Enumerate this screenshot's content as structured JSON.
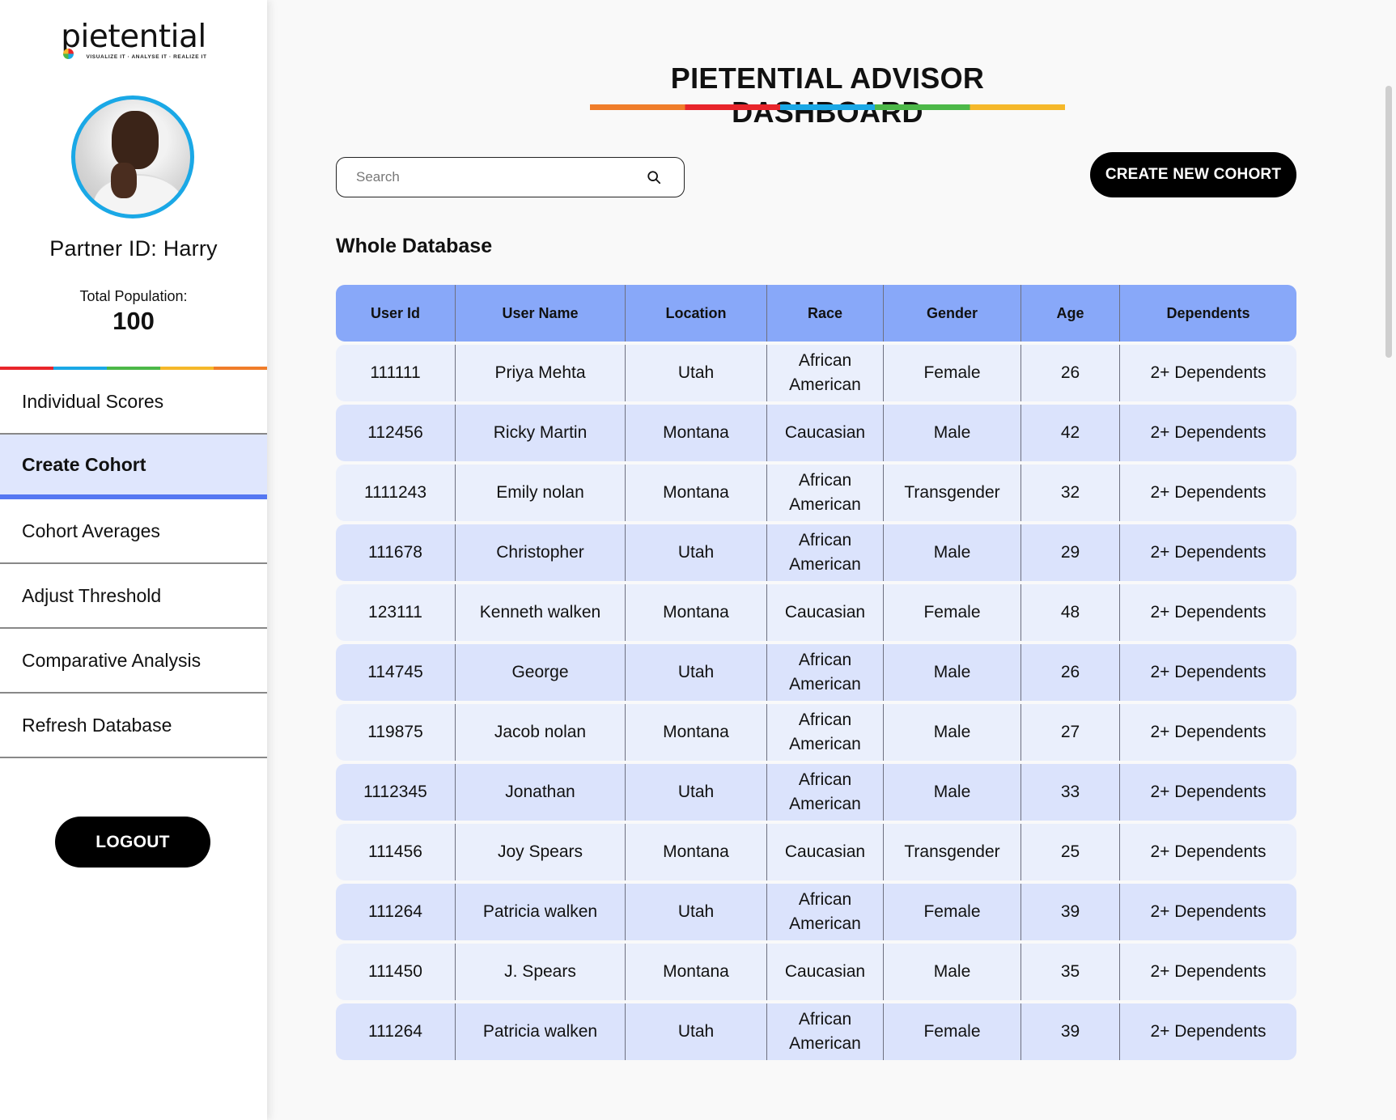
{
  "app": {
    "logo_text": "pietential",
    "logo_tagline": "VISUALIZE IT · ANALYSE IT · REALIZE IT"
  },
  "sidebar": {
    "partner_id": "Partner ID: Harry",
    "population_label": "Total Population:",
    "population_value": "100",
    "nav": [
      {
        "label": "Individual Scores",
        "active": false
      },
      {
        "label": "Create Cohort",
        "active": true
      },
      {
        "label": "Cohort Averages",
        "active": false
      },
      {
        "label": "Adjust Threshold",
        "active": false
      },
      {
        "label": "Comparative Analysis",
        "active": false
      },
      {
        "label": "Refresh Database",
        "active": false
      }
    ],
    "logout_label": "LOGOUT"
  },
  "header": {
    "title": "PIETENTIAL ADVISOR DASHBOARD"
  },
  "toolbar": {
    "search_placeholder": "Search",
    "search_value": "",
    "create_label": "CREATE NEW COHORT"
  },
  "section": {
    "title": "Whole Database"
  },
  "table": {
    "columns": [
      "User Id",
      "User Name",
      "Location",
      "Race",
      "Gender",
      "Age",
      "Dependents"
    ],
    "rows": [
      [
        "111111",
        "Priya Mehta",
        "Utah",
        "African American",
        "Female",
        "26",
        "2+ Dependents"
      ],
      [
        "112456",
        "Ricky Martin",
        "Montana",
        "Caucasian",
        "Male",
        "42",
        "2+ Dependents"
      ],
      [
        "1111243",
        "Emily nolan",
        "Montana",
        "African American",
        "Transgender",
        "32",
        "2+ Dependents"
      ],
      [
        "111678",
        "Christopher",
        "Utah",
        "African American",
        "Male",
        "29",
        "2+ Dependents"
      ],
      [
        "123111",
        "Kenneth walken",
        "Montana",
        "Caucasian",
        "Female",
        "48",
        "2+ Dependents"
      ],
      [
        "114745",
        "George",
        "Utah",
        "African American",
        "Male",
        "26",
        "2+ Dependents"
      ],
      [
        "119875",
        "Jacob nolan",
        "Montana",
        "African American",
        "Male",
        "27",
        "2+ Dependents"
      ],
      [
        "1112345",
        "Jonathan",
        "Utah",
        "African American",
        "Male",
        "33",
        "2+ Dependents"
      ],
      [
        "111456",
        "Joy Spears",
        "Montana",
        "Caucasian",
        "Transgender",
        "25",
        "2+ Dependents"
      ],
      [
        "111264",
        "Patricia walken",
        "Utah",
        "African American",
        "Female",
        "39",
        "2+ Dependents"
      ],
      [
        "111450",
        "J. Spears",
        "Montana",
        "Caucasian",
        "Male",
        "35",
        "2+ Dependents"
      ],
      [
        "111264",
        "Patricia walken",
        "Utah",
        "African American",
        "Female",
        "39",
        "2+ Dependents"
      ]
    ]
  },
  "colors": {
    "accent_blue": "#5577f2",
    "header_blue": "#88a8f9",
    "row_light": "#eaeffc",
    "row_dark": "#dbe3fc",
    "brand_orange": "#f07d2a",
    "brand_red": "#e8252b",
    "brand_cyan": "#1aa8e6",
    "brand_green": "#4cb848",
    "brand_yellow": "#f5b82a"
  }
}
